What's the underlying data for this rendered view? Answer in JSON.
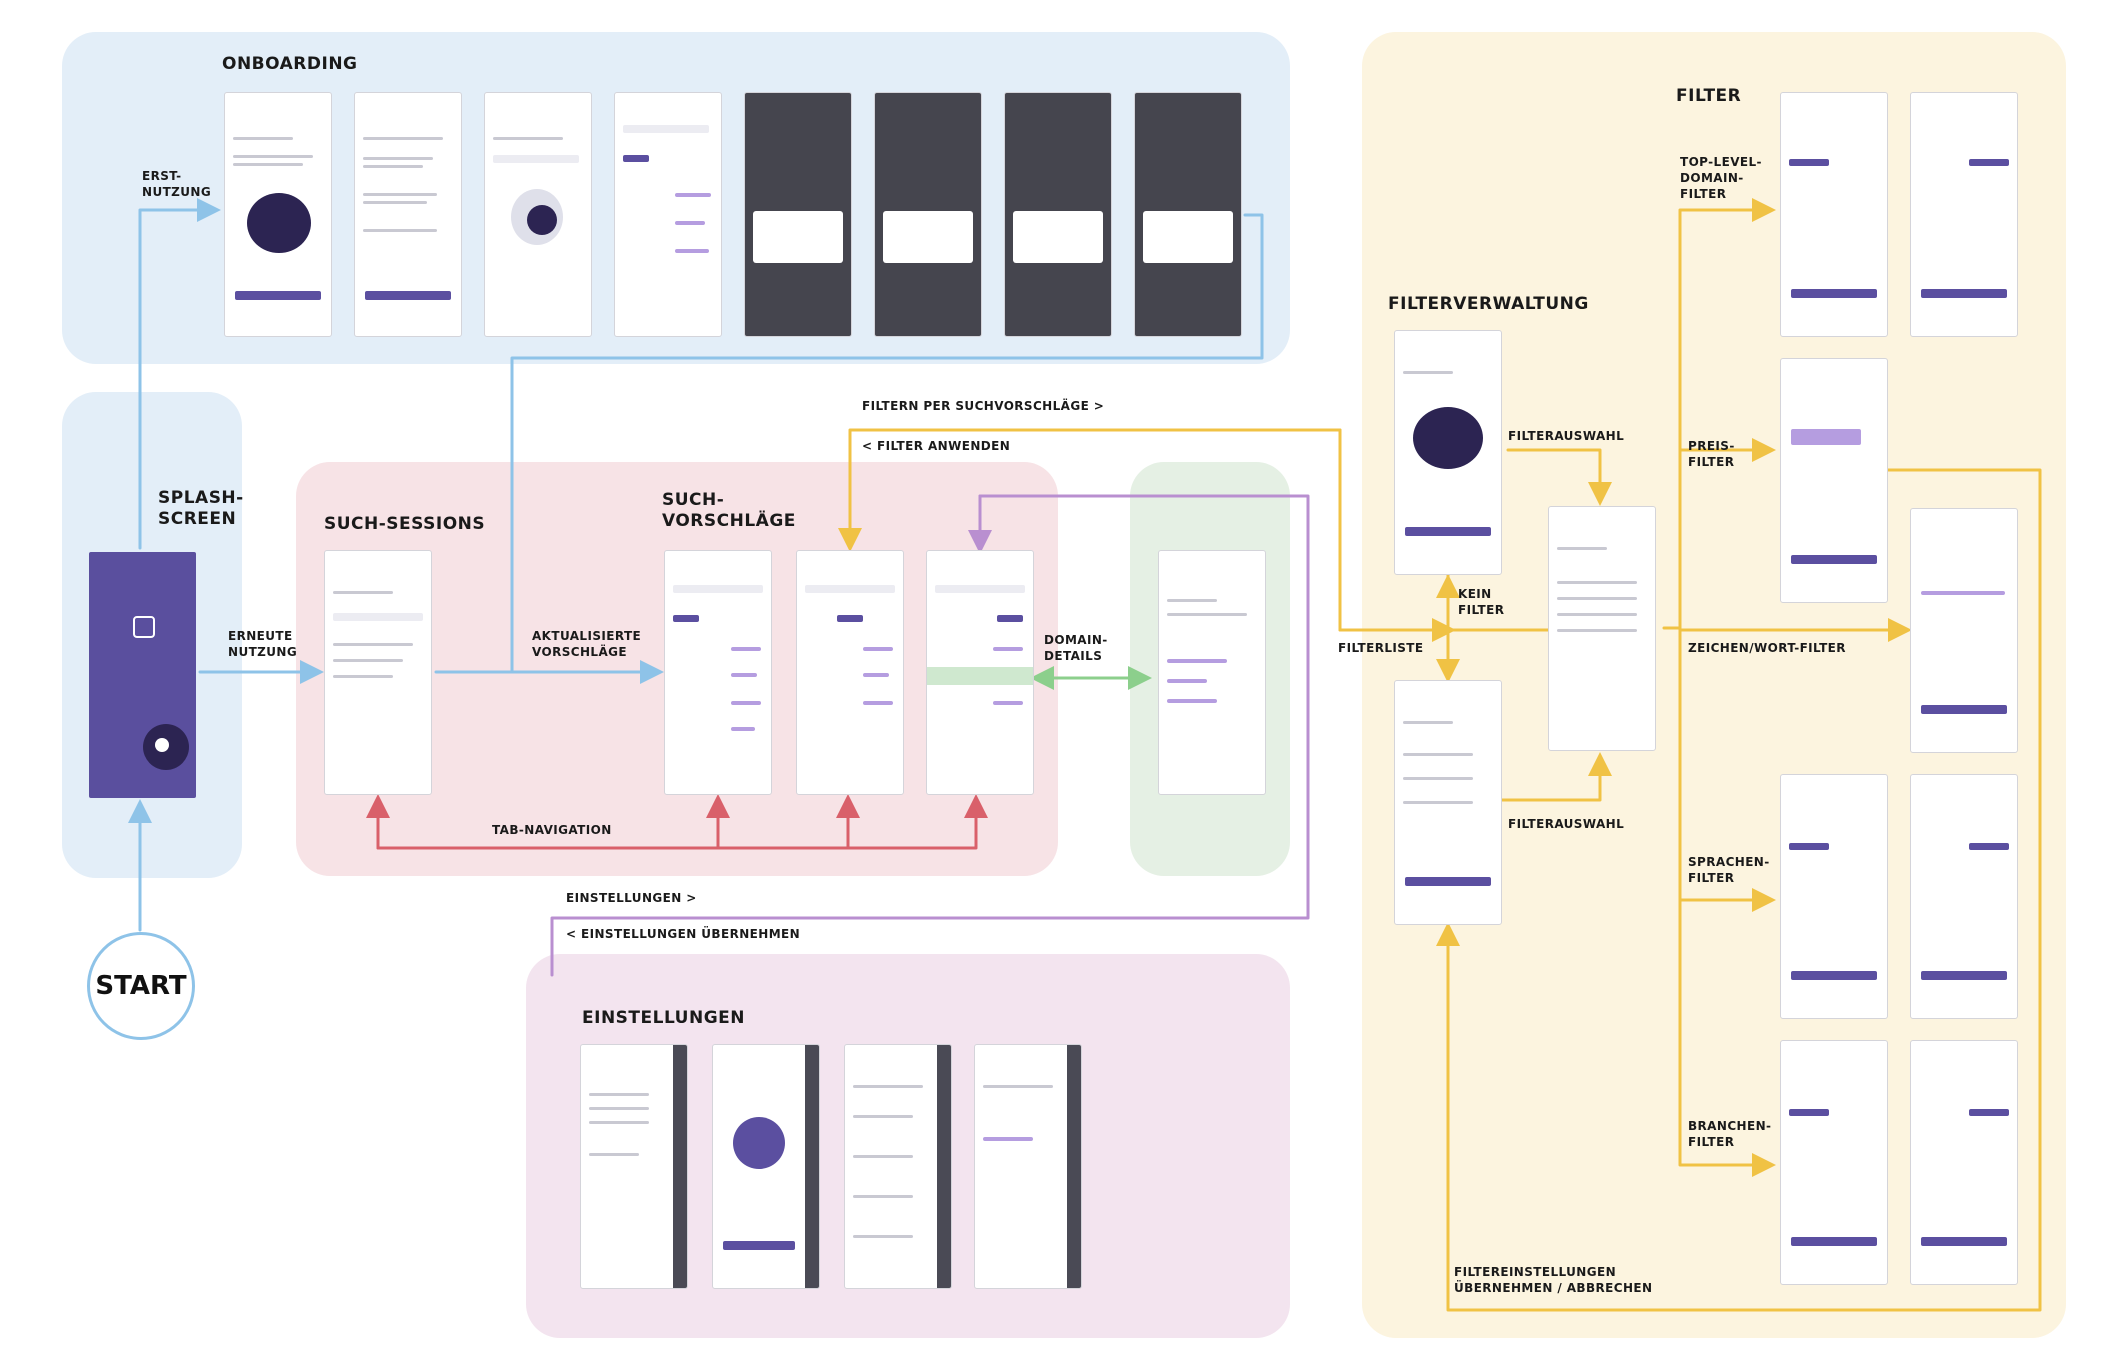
{
  "sections": {
    "onboarding": "ONBOARDING",
    "splash_screen": "SPLASH-\nSCREEN",
    "such_sessions": "SUCH-SESSIONS",
    "such_vorschlaege": "SUCH-\nVORSCHLÄGE",
    "einstellungen": "EINSTELLUNGEN",
    "filterverwaltung": "FILTERVERWALTUNG",
    "filter": "FILTER",
    "start": "START"
  },
  "transitions": {
    "erst_nutzung": "ERST-\nNUTZUNG",
    "erneute_nutzung": "ERNEUTE\nNUTZUNG",
    "aktualisierte_vorschlaege": "AKTUALISIERTE\nVORSCHLÄGE",
    "filtern_per_suchvorschlaege": "FILTERN PER SUCHVORSCHLÄGE >",
    "filter_anwenden": "< FILTER ANWENDEN",
    "domain_details": "DOMAIN-\nDETAILS",
    "tab_navigation": "TAB-NAVIGATION",
    "einstellungen_link": "EINSTELLUNGEN >",
    "einstellungen_uebernehmen": "< EINSTELLUNGEN ÜBERNEHMEN",
    "filterauswahl_top": "FILTERAUSWAHL",
    "filterauswahl_bottom": "FILTERAUSWAHL",
    "kein_filter": "KEIN\nFILTER",
    "filterliste": "FILTERLISTE",
    "filtereinstellungen": "FILTEREINSTELLUNGEN\nÜBERNEHMEN / ABBRECHEN"
  },
  "filter_types": {
    "top_level_domain": "TOP-LEVEL-\nDOMAIN-\nFILTER",
    "preis": "PREIS-\nFILTER",
    "zeichen_wort": "ZEICHEN/WORT-FILTER",
    "sprachen": "SPRACHEN-\nFILTER",
    "branchen": "BRANCHEN-\nFILTER"
  },
  "colors": {
    "onboarding_bg": "#e3eef8",
    "sessions_bg": "#f7e3e6",
    "details_bg": "#e5f0e4",
    "settings_bg": "#f3e4ef",
    "filter_bg": "#fcf4df",
    "blue_arrow": "#8ec3e8",
    "yellow_arrow": "#f0c244",
    "red_arrow": "#d9606a",
    "purple_arrow": "#b98fd0",
    "green_arrow": "#8ccf8c",
    "accent": "#5b4fa0"
  }
}
